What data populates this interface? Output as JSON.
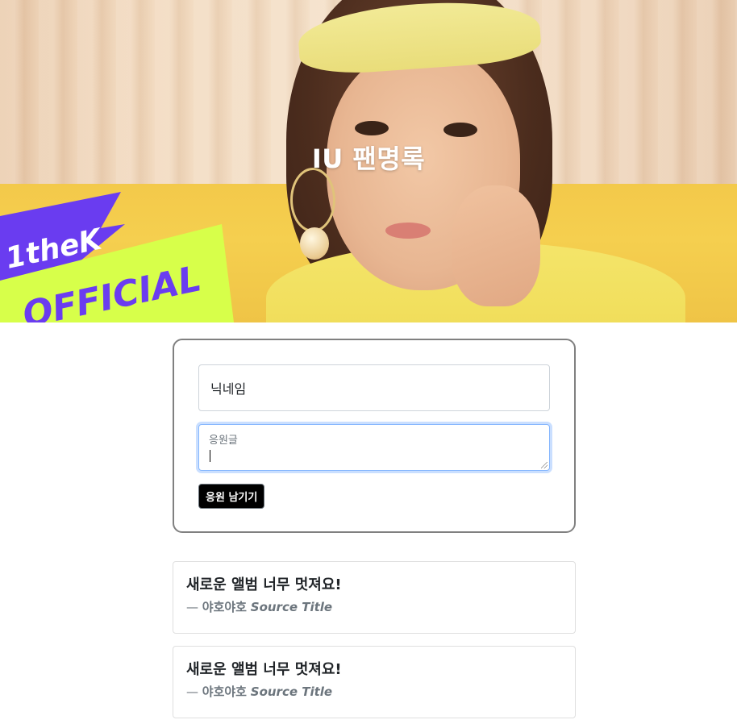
{
  "hero": {
    "title": "IU 팬명록",
    "logo_line1": "1theK",
    "logo_line2": "OFFICIAL"
  },
  "form": {
    "nickname_value": "닉네임",
    "message_placeholder": "응원글",
    "submit_label": "응원 남기기"
  },
  "comments": [
    {
      "text": "새로운 앨범 너무 멋져요!",
      "dash": "—",
      "author": "야호야호",
      "source": "Source Title"
    },
    {
      "text": "새로운 앨범 너무 멋져요!",
      "dash": "—",
      "author": "야호야호",
      "source": "Source Title"
    }
  ],
  "colors": {
    "logo_purple": "#6a3cf0",
    "logo_lime": "#d7ff4a",
    "button_bg": "#000000",
    "card_border": "#808080",
    "focus_border": "#86b7fe"
  }
}
